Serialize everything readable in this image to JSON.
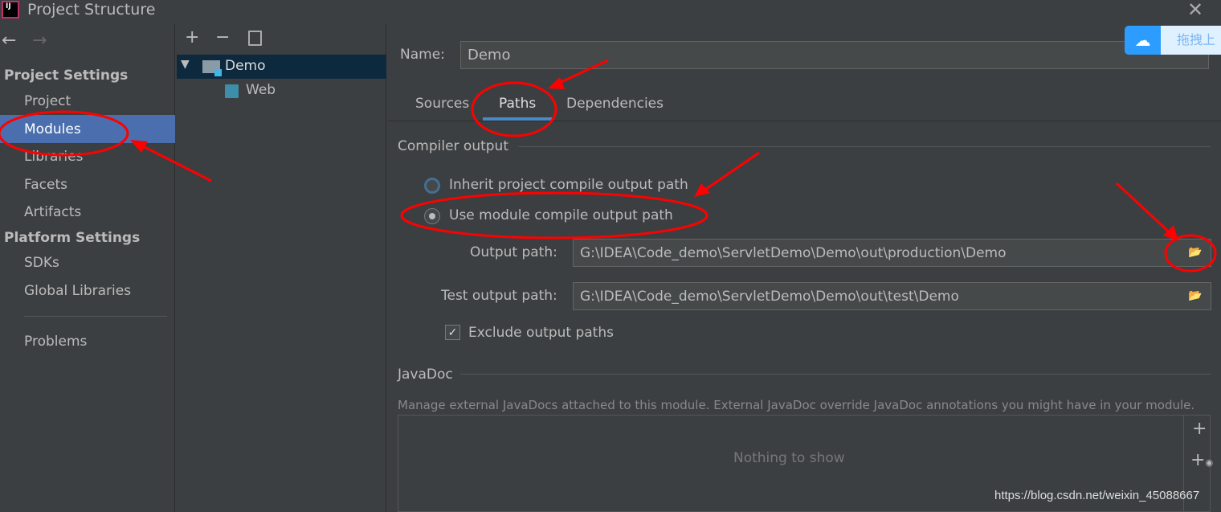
{
  "window": {
    "title": "Project Structure",
    "logo": "IJ"
  },
  "sidebar": {
    "sections": [
      {
        "label": "Project Settings",
        "items": [
          "Project",
          "Modules",
          "Libraries",
          "Facets",
          "Artifacts"
        ]
      },
      {
        "label": "Platform Settings",
        "items": [
          "SDKs",
          "Global Libraries"
        ]
      }
    ],
    "problems": "Problems",
    "selected": "Modules"
  },
  "tree": {
    "items": [
      {
        "label": "Demo",
        "expanded": true
      },
      {
        "label": "Web"
      }
    ]
  },
  "module": {
    "name_label": "Name:",
    "name_value": "Demo",
    "tabs": [
      "Sources",
      "Paths",
      "Dependencies"
    ],
    "active_tab": "Paths",
    "compiler_output": "Compiler output",
    "inherit_label": "Inherit project compile output path",
    "use_module_label": "Use module compile output path",
    "selected_radio": "use_module",
    "output_path_label": "Output path:",
    "output_path": "G:\\IDEA\\Code_demo\\ServletDemo\\Demo\\out\\production\\Demo",
    "test_output_label": "Test output path:",
    "test_output_path": "G:\\IDEA\\Code_demo\\ServletDemo\\Demo\\out\\test\\Demo",
    "exclude_label": "Exclude output paths",
    "exclude_checked": true,
    "javadoc": "JavaDoc",
    "javadoc_desc": "Manage external JavaDocs attached to this module. External JavaDoc override JavaDoc annotations you might have in your module.",
    "empty": "Nothing to show"
  },
  "overlay": {
    "baidu_label": "拖拽上",
    "watermark": "https://blog.csdn.net/weixin_45088667"
  },
  "colors": {
    "selection": "#4b6eaf",
    "tree_selection": "#0d293e",
    "tab_underline": "#4a88c7",
    "annotation": "#ff0000"
  }
}
